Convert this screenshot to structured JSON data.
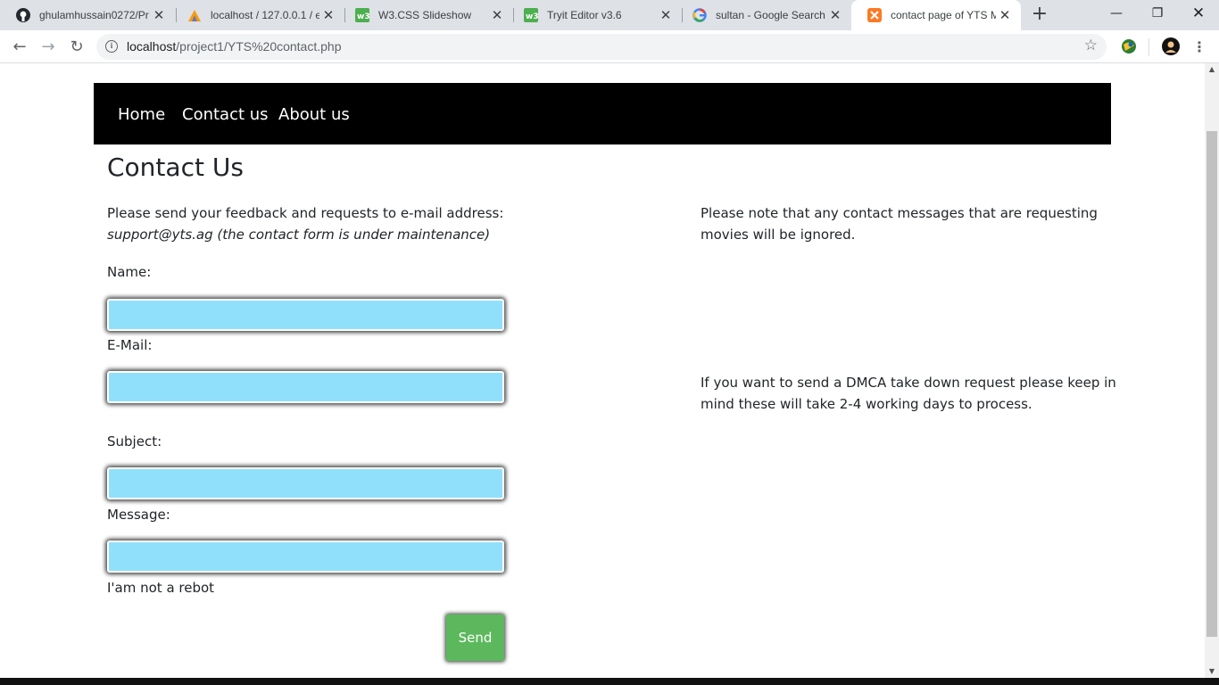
{
  "browser": {
    "tabs": [
      {
        "title": "ghulamhussain0272/Pr",
        "icon": "github-icon"
      },
      {
        "title": "localhost / 127.0.0.1 / e",
        "icon": "phpmyadmin-icon"
      },
      {
        "title": "W3.CSS Slideshow",
        "icon": "w3schools-icon"
      },
      {
        "title": "Tryit Editor v3.6",
        "icon": "w3schools-icon"
      },
      {
        "title": "sultan - Google Search",
        "icon": "google-icon"
      },
      {
        "title": "contact page of YTS MC",
        "icon": "xampp-icon"
      }
    ],
    "url_host": "localhost",
    "url_path": "/project1/YTS%20contact.php"
  },
  "navbar": {
    "links": [
      "Home",
      "Contact us",
      "About us"
    ]
  },
  "page": {
    "heading": "Contact Us",
    "intro_line1": "Please send your feedback and requests to e-mail address:",
    "intro_line2": "support@yts.ag (the contact form is under maintenance)",
    "note1_line1": "Please note that any contact messages that are requesting",
    "note1_line2": "movies will be ignored.",
    "note2_line1": "If you want to send a DMCA take down request please keep in",
    "note2_line2": "mind these will take 2-4 working days to process."
  },
  "form": {
    "name_label": "Name:",
    "email_label": "E-Mail:",
    "subject_label": "Subject:",
    "message_label": "Message:",
    "robot_text": "I'am not a rebot",
    "send_label": "Send"
  },
  "colors": {
    "navbar_bg": "#000000",
    "field_bg": "#90e0fc",
    "send_bg": "#5cb85c"
  }
}
